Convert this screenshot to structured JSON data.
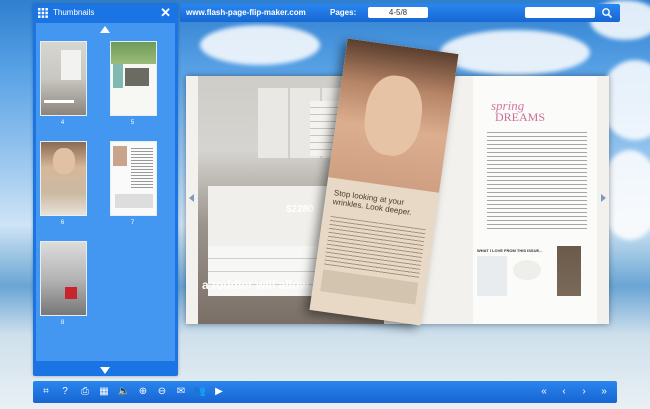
{
  "topbar": {
    "site": "www.flash-page-flip-maker.com",
    "pages_label": "Pages:",
    "page_value": "4-5/8",
    "search_placeholder": ""
  },
  "thumbnails": {
    "title": "Thumbnails",
    "items": [
      {
        "label": "4"
      },
      {
        "label": "5"
      },
      {
        "label": "6"
      },
      {
        "label": "7"
      },
      {
        "label": "8"
      }
    ]
  },
  "book": {
    "left_headline": "a toddler will allow.",
    "left_price": "$2280",
    "right_title_spring": "spring",
    "right_title_dreams": "DREAMS",
    "right_section": "WHAT I LOVE FROM THIS ISSUE...",
    "flip_tagline": "Stop looking at your wrinkles. Look deeper."
  },
  "toolbar": {
    "icons": [
      "fit-icon",
      "help-icon",
      "print-icon",
      "thumbnails-icon",
      "sound-icon",
      "zoom-in-icon",
      "zoom-out-icon",
      "email-icon",
      "share-icon",
      "autoplay-icon",
      "first-page-icon",
      "prev-page-icon",
      "next-page-icon",
      "last-page-icon"
    ]
  },
  "colors": {
    "accent": "#1b74e4",
    "toolbar": "#1f7be6"
  }
}
